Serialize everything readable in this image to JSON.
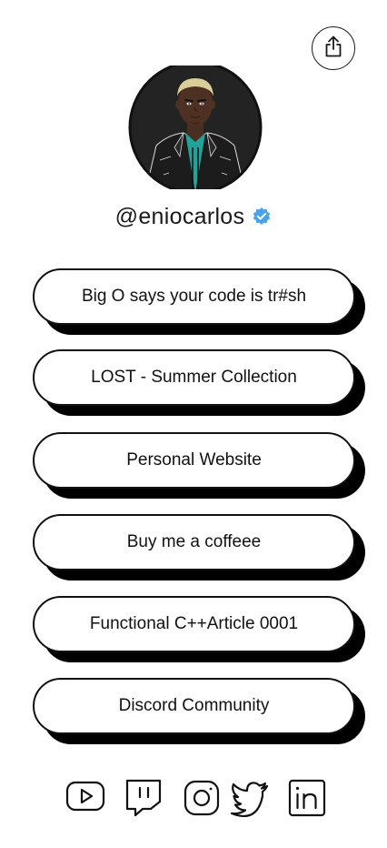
{
  "profile": {
    "handle": "@eniocarlos",
    "verified": true,
    "avatar": "cartoon-avatar-illustration"
  },
  "header": {
    "share_icon": "share-icon"
  },
  "links": [
    {
      "label": "Big O says your code is tr#sh"
    },
    {
      "label": "LOST - Summer Collection"
    },
    {
      "label": "Personal Website"
    },
    {
      "label": "Buy me a coffeee"
    },
    {
      "label": "Functional C++Article 0001"
    },
    {
      "label": "Discord Community"
    }
  ],
  "socials": [
    {
      "icon": "youtube-icon"
    },
    {
      "icon": "twitch-icon"
    },
    {
      "icon": "instagram-icon"
    },
    {
      "icon": "twitter-icon"
    },
    {
      "icon": "linkedin-icon"
    }
  ],
  "colors": {
    "background": "#ffffff",
    "ink": "#111111",
    "shadow": "#000000",
    "verified_badge": "#4aa3e8"
  }
}
